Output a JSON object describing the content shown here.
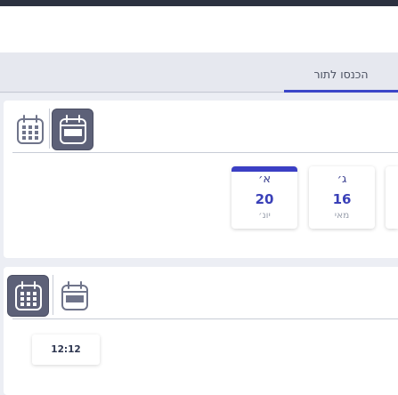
{
  "tabs": [
    {
      "label": "הכנסו לתור",
      "active": true
    }
  ],
  "date_section": {
    "views": [
      {
        "icon": "calendar-month-icon",
        "active": false
      },
      {
        "icon": "calendar-week-icon",
        "active": true
      }
    ],
    "days": [
      {
        "dow": "א׳",
        "day": "20",
        "month": "יונ׳",
        "selected": true
      },
      {
        "dow": "ג׳",
        "day": "16",
        "month": "מאי",
        "selected": false
      }
    ]
  },
  "time_section": {
    "views": [
      {
        "icon": "calendar-month-icon",
        "active": true
      },
      {
        "icon": "calendar-week-icon",
        "active": false
      }
    ],
    "times": [
      "12:12"
    ]
  },
  "colors": {
    "accent": "#3b46c8",
    "active_button": "#5d6178",
    "topbar": "#2c3140"
  }
}
